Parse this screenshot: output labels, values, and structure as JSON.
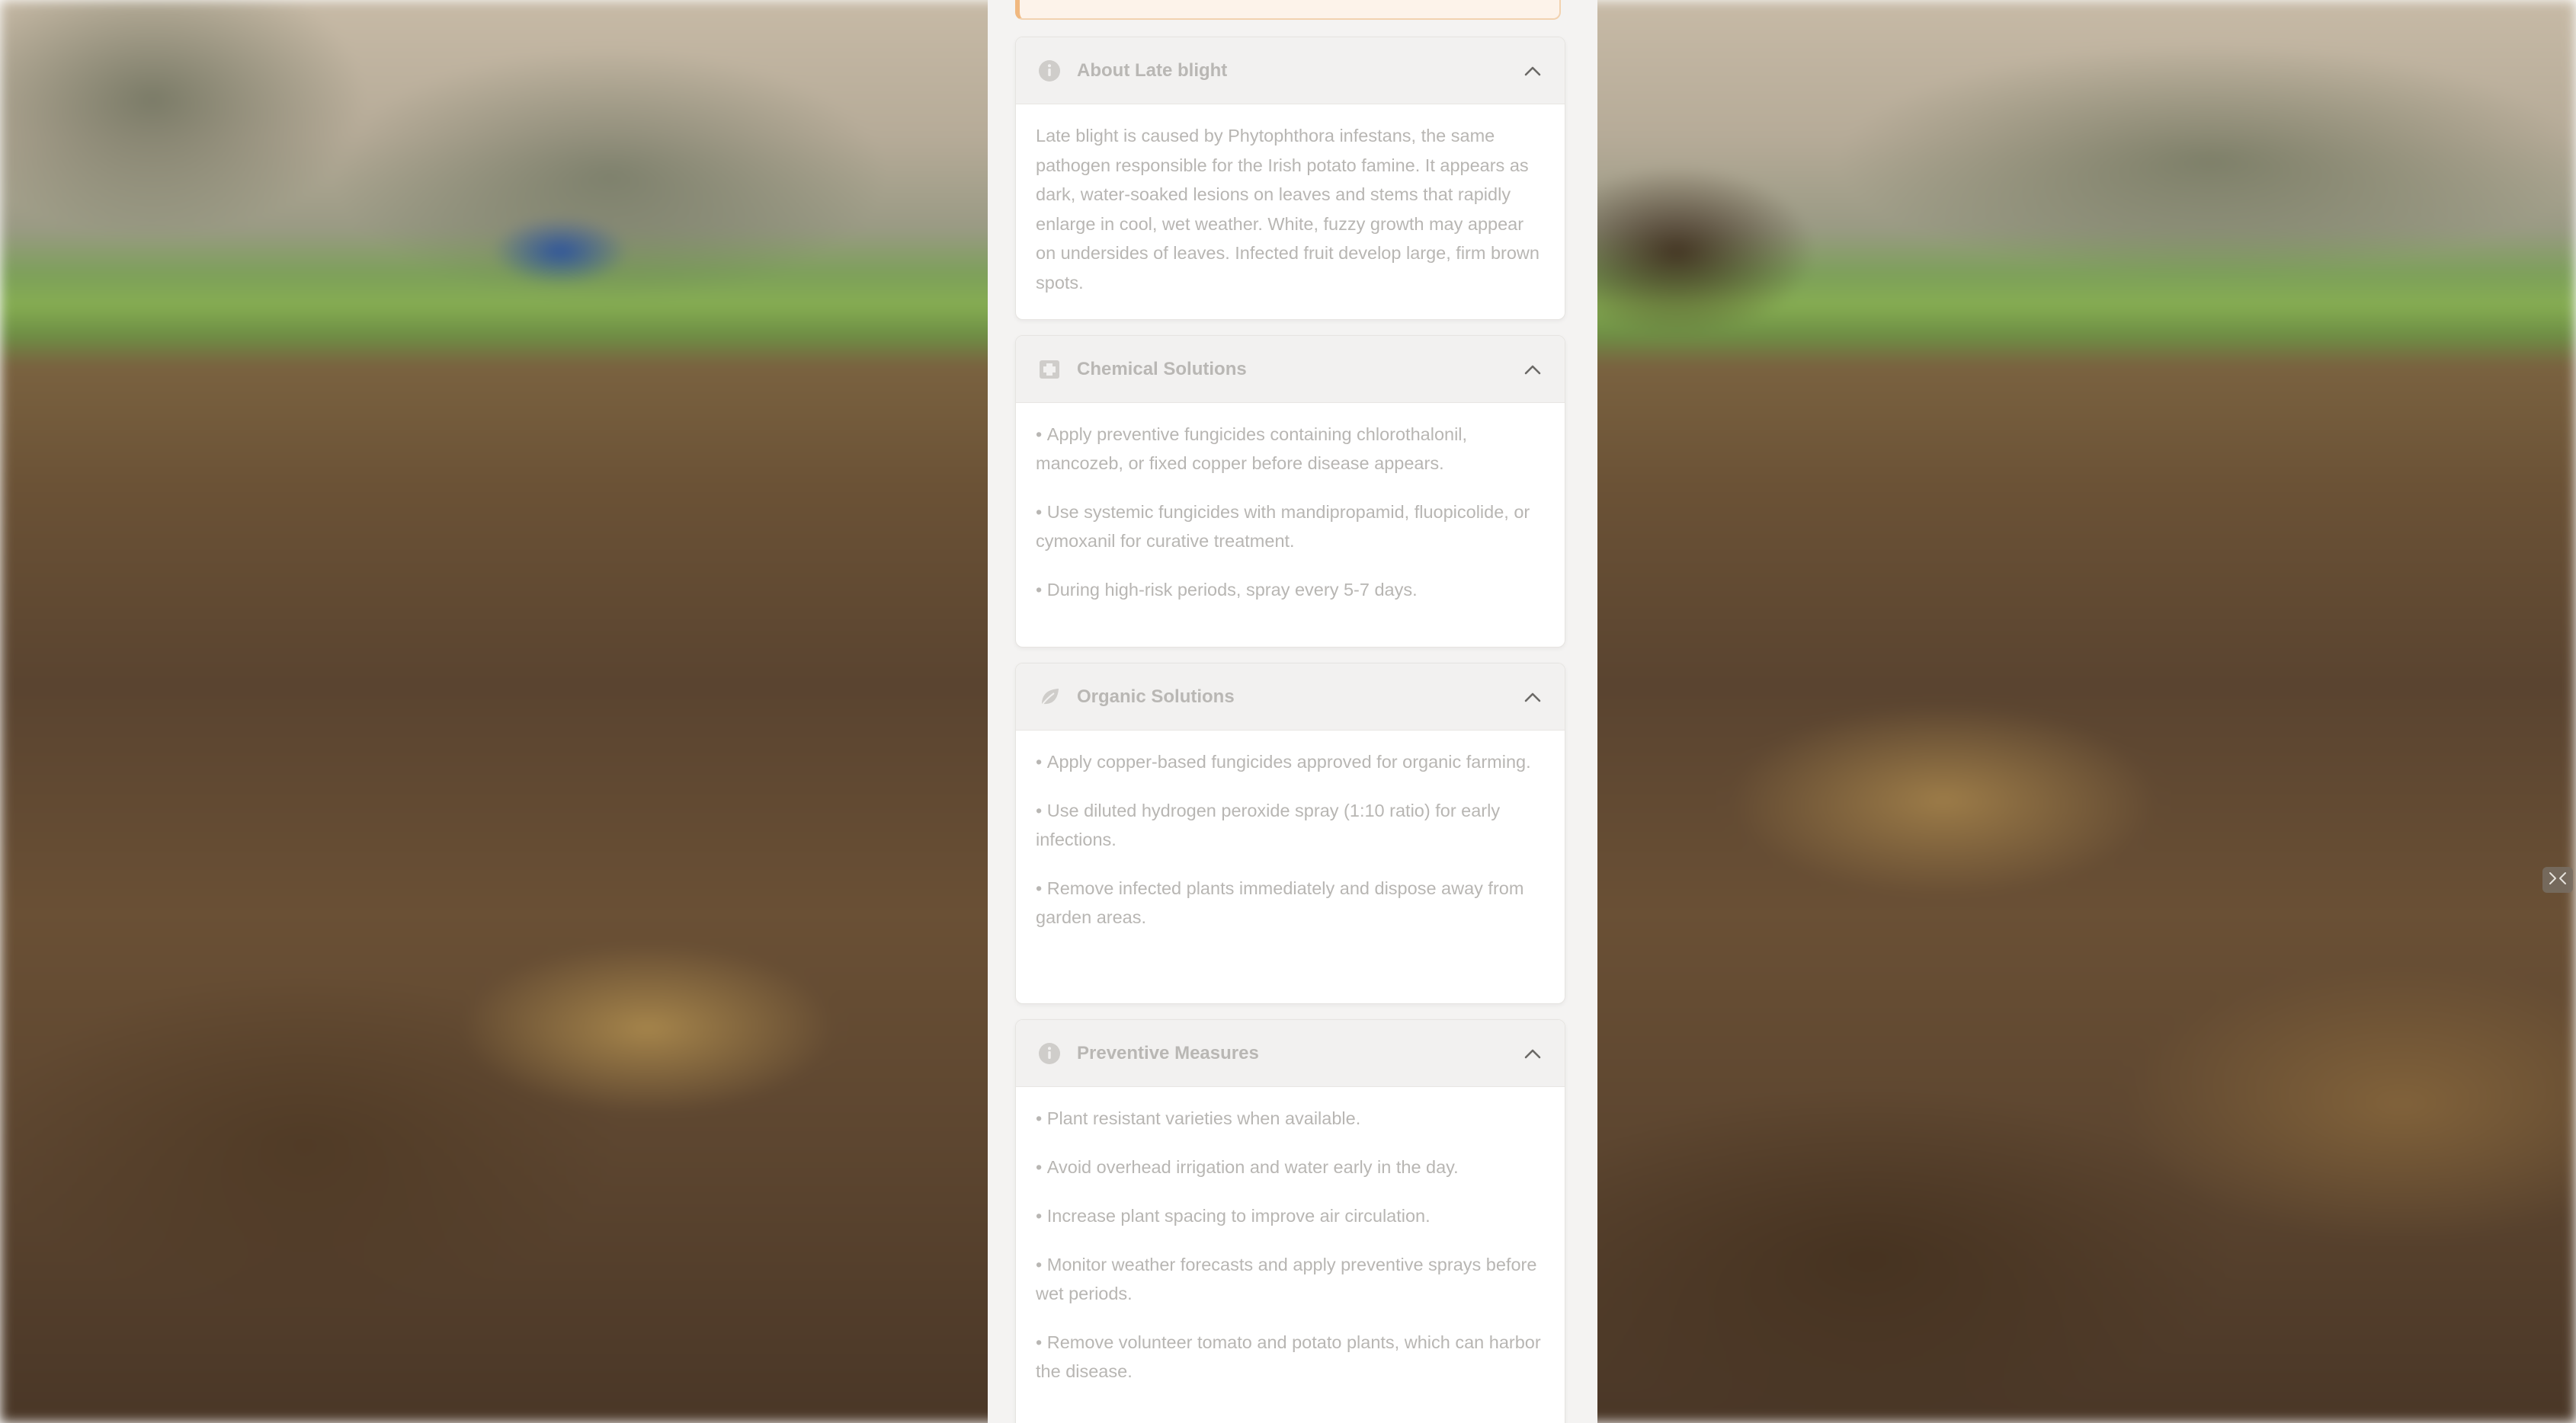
{
  "about": {
    "title": "About Late blight",
    "icon": "info-icon",
    "description": "Late blight is caused by Phytophthora infestans, the same pathogen responsible for the Irish potato famine. It appears as dark, water-soaked lesions on leaves and stems that rapidly enlarge in cool, wet weather. White, fuzzy growth may appear on undersides of leaves. Infected fruit develop large, firm brown spots."
  },
  "chemical": {
    "title": "Chemical Solutions",
    "icon": "flask-icon",
    "items": [
      "Apply preventive fungicides containing chlorothalonil, mancozeb, or fixed copper before disease appears.",
      "Use systemic fungicides with mandipropamid, fluopicolide, or cymoxanil for curative treatment.",
      "During high-risk periods, spray every 5-7 days."
    ]
  },
  "organic": {
    "title": "Organic Solutions",
    "icon": "leaf-icon",
    "items": [
      "Apply copper-based fungicides approved for organic farming.",
      "Use diluted hydrogen peroxide spray (1:10 ratio) for early infections.",
      "Remove infected plants immediately and dispose away from garden areas."
    ]
  },
  "preventive": {
    "title": "Preventive Measures",
    "icon": "info-icon",
    "items": [
      "Plant resistant varieties when available.",
      "Avoid overhead irrigation and water early in the day.",
      "Increase plant spacing to improve air circulation.",
      "Monitor weather forecasts and apply preventive sprays before wet periods.",
      "Remove volunteer tomato and potato plants, which can harbor the disease."
    ]
  },
  "colors": {
    "panel_bg": "#f4f3f2",
    "header_bg": "#f2f1f0",
    "text": "#b8b6b3",
    "alert_border": "#f0b880"
  }
}
